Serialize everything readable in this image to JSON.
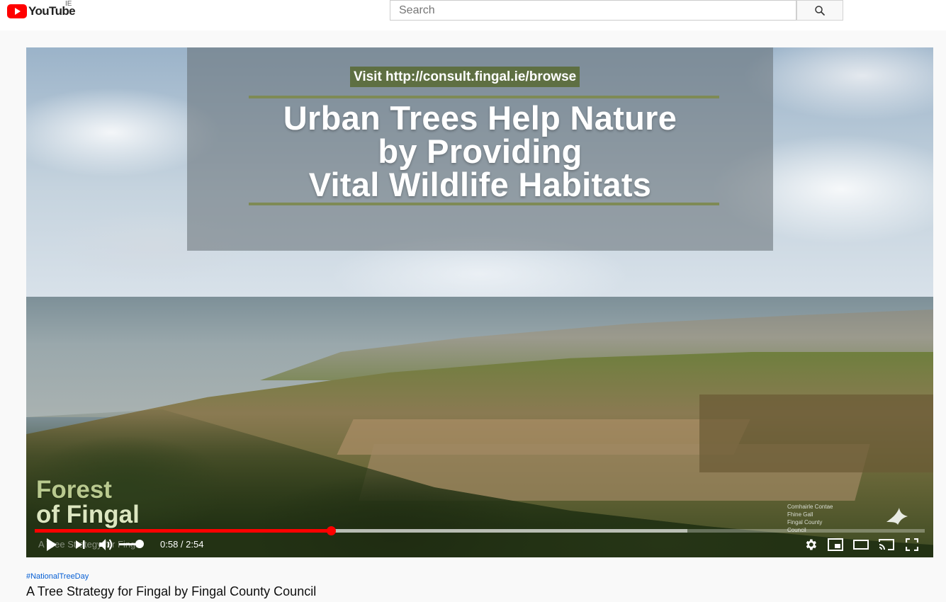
{
  "header": {
    "logo_text": "YouTube",
    "country_code": "IE",
    "search_placeholder": "Search",
    "search_icon": "search-icon"
  },
  "video_frame": {
    "visit_text": "Visit http://consult.fingal.ie/browse",
    "headline": [
      "Urban Trees Help Nature",
      "by Providing",
      "Vital Wildlife Habitats"
    ],
    "brand_line1": "Forest",
    "brand_line2": "of Fingal",
    "council_lines": [
      "Comhairle Contae",
      "Fhine Gall",
      "Fingal County",
      "Council"
    ]
  },
  "player": {
    "ghost_title": "A Tree Strategy for Fingal",
    "time_current": "0:58",
    "time_total": "2:54",
    "time_display": "0:58 / 2:54",
    "played_fraction": 0.333,
    "buffered_fraction": 0.733,
    "volume_fraction": 0.72,
    "progress_color": "#ff0000",
    "icons": {
      "play": "play-icon",
      "next": "next-icon",
      "volume": "volume-icon",
      "settings": "gear-icon",
      "miniplayer": "miniplayer-icon",
      "theater": "theater-mode-icon",
      "cast": "cast-icon",
      "fullscreen": "fullscreen-icon"
    }
  },
  "below": {
    "hashtag": "#NationalTreeDay",
    "title": "A Tree Strategy for Fingal by Fingal County Council",
    "hashtag_color": "#065fd4"
  }
}
